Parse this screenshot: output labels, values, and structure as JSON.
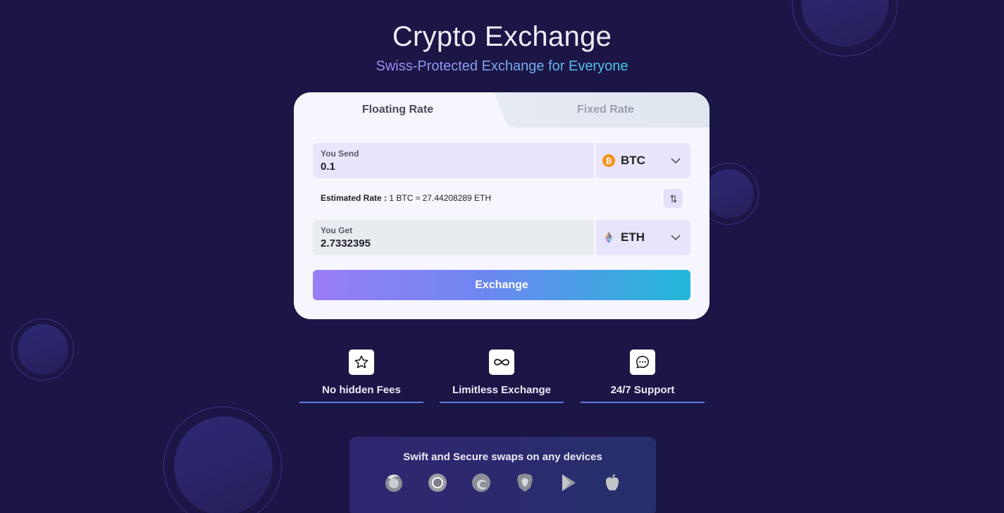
{
  "header": {
    "title": "Crypto Exchange",
    "subtitle": "Swiss-Protected Exchange for Everyone"
  },
  "tabs": {
    "floating": "Floating Rate",
    "fixed": "Fixed Rate",
    "active": "Floating Rate"
  },
  "send": {
    "label": "You Send",
    "value": "0.1",
    "coin": "BTC",
    "coin_icon": "bitcoin-icon"
  },
  "rate": {
    "label": "Estimated Rate :",
    "value": "1 BTC ≈ 27.44208289 ETH"
  },
  "get": {
    "label": "You Get",
    "value": "2.7332395",
    "coin": "ETH",
    "coin_icon": "ethereum-icon"
  },
  "exchange_button": "Exchange",
  "features": [
    {
      "label": "No hidden Fees",
      "icon": "star-icon"
    },
    {
      "label": "Limitless Exchange",
      "icon": "infinity-icon"
    },
    {
      "label": "24/7 Support",
      "icon": "chat-icon"
    }
  ],
  "devices": {
    "text": "Swift and Secure swaps on any devices",
    "icons": [
      "firefox-icon",
      "chrome-icon",
      "edge-icon",
      "brave-icon",
      "google-play-icon",
      "apple-icon"
    ]
  },
  "colors": {
    "background": "#1c1646",
    "card": "#f7f6fe",
    "accent_start": "#9a7ef8",
    "accent_end": "#22b9d9",
    "feature_line": "#5b7be6"
  }
}
